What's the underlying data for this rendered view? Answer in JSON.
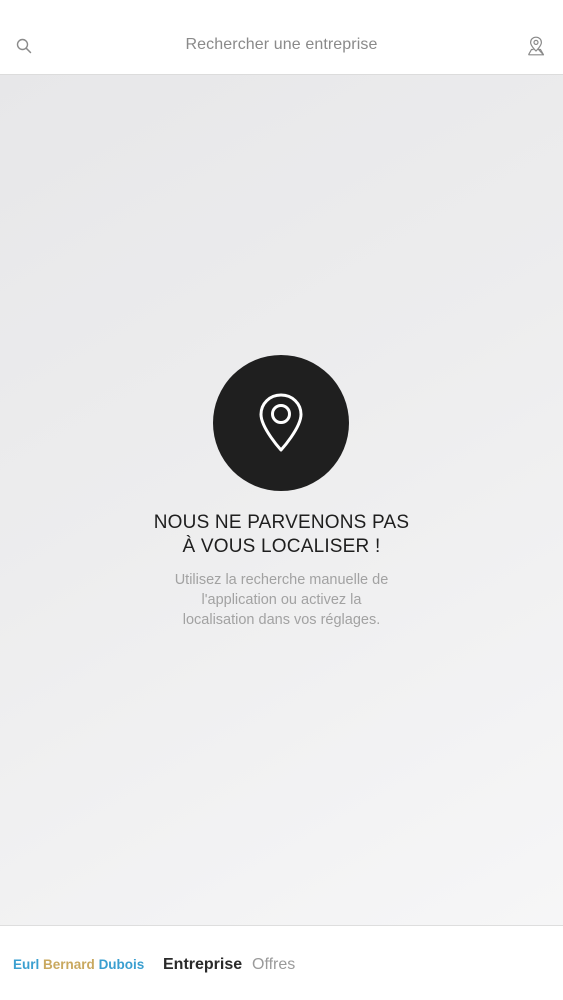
{
  "header": {
    "title": "Rechercher une entreprise",
    "search_icon": "search-icon",
    "location_icon": "user-location-icon"
  },
  "empty_state": {
    "icon": "map-pin-icon",
    "headline_line1": "NOUS NE PARVENONS PAS",
    "headline_line2": "À VOUS LOCALISER !",
    "message_line1": "Utilisez la recherche manuelle de",
    "message_line2": "l'application ou activez la",
    "message_line3": "localisation dans vos réglages."
  },
  "footer": {
    "brand": {
      "word1": "Eurl",
      "word2": "Bernard",
      "word3": "Dubois"
    },
    "tabs": [
      {
        "label": "Entreprise",
        "active": true
      },
      {
        "label": "Offres",
        "active": false
      }
    ]
  },
  "colors": {
    "brand_blue": "#3a9fd0",
    "brand_gold": "#c9a85f",
    "circle_dark": "#1f1f1f"
  }
}
